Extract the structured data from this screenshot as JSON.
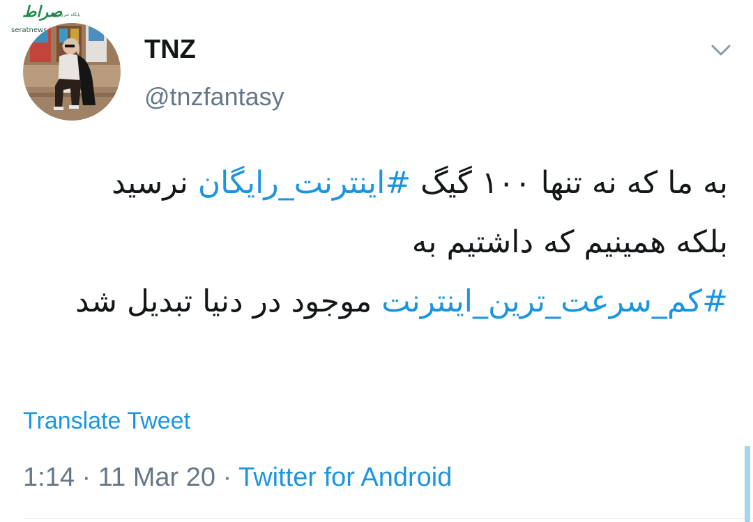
{
  "watermark": {
    "logo_text": "صراط",
    "subtitle": "پایگاه خبری تحلیلی",
    "url": "seratnews.ir"
  },
  "author": {
    "name": "TNZ",
    "handle": "@tnzfantasy"
  },
  "tweet": {
    "part1": "به ما که نه تنها ۱۰۰ گیگ ",
    "hashtag1": "#اینترنت_رایگان",
    "part2": " نرسید بلکه همینیم که داشتیم به ",
    "hashtag2": "#کم_سرعت_ترین_اینترنت",
    "part3": " موجود در دنیا تبدیل شد"
  },
  "translate_label": "Translate Tweet",
  "meta": {
    "time": "1:14",
    "separator1": " · ",
    "date": "11 Mar 20",
    "separator2": " · ",
    "source": "Twitter for Android"
  },
  "icons": {
    "menu": "chevron-down-icon"
  },
  "colors": {
    "link": "#1b95e0",
    "text": "#14171a",
    "muted": "#657786"
  }
}
